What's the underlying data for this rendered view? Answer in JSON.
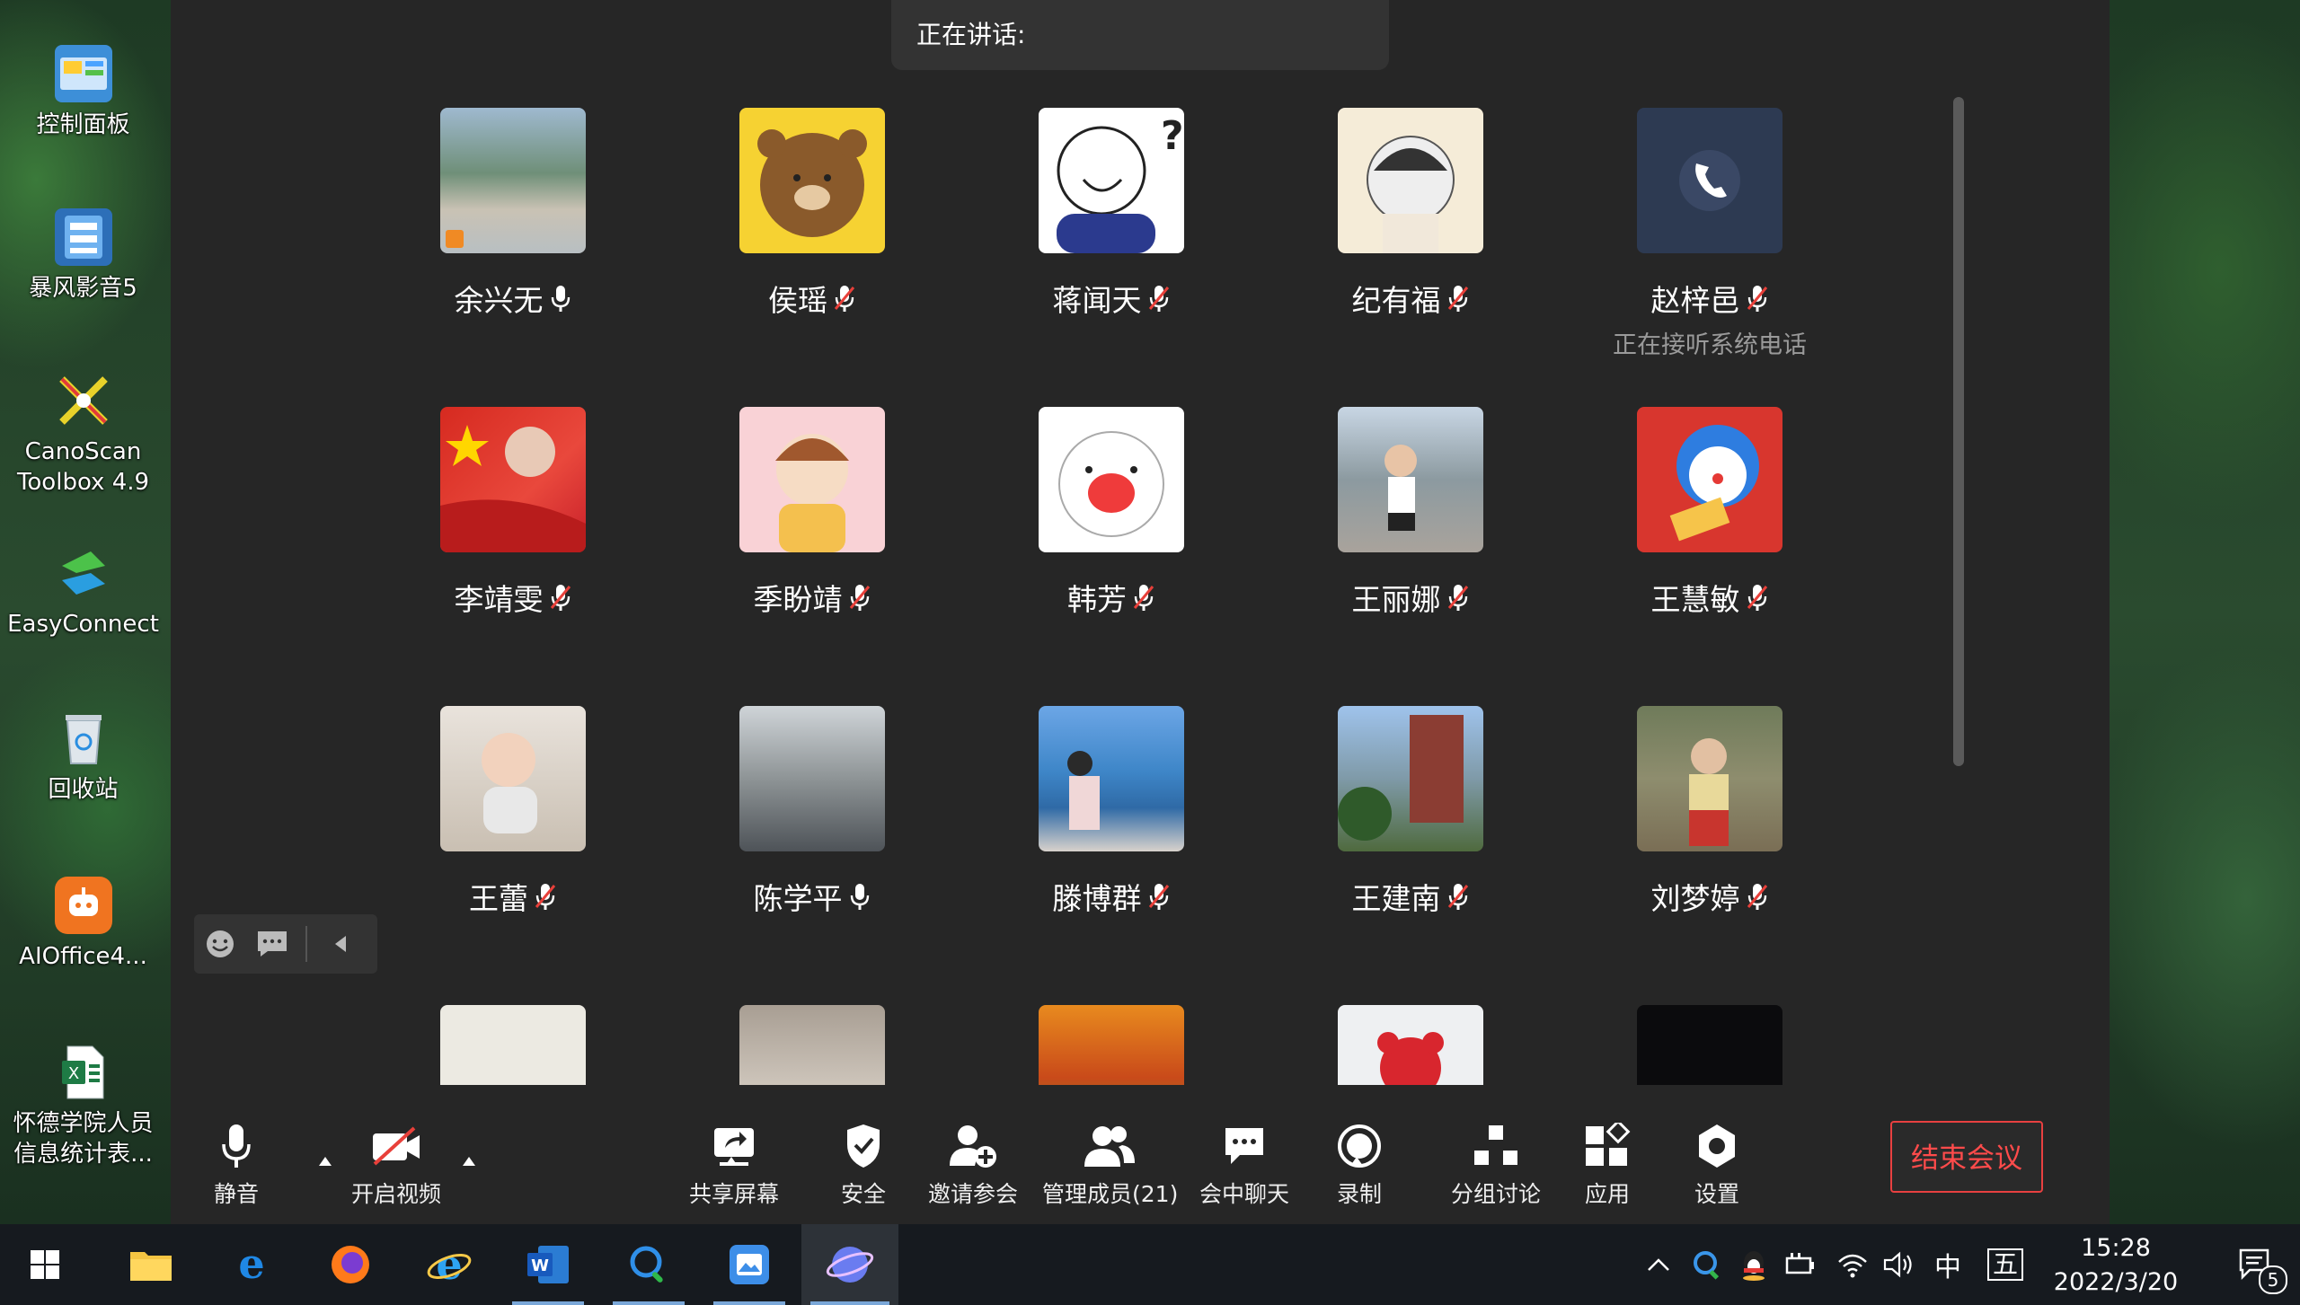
{
  "desktop": {
    "icons": [
      {
        "label": "控制面板"
      },
      {
        "label": "暴风影音5"
      },
      {
        "label": "CanoScan Toolbox 4.9"
      },
      {
        "label": "EasyConnect"
      },
      {
        "label": "回收站"
      },
      {
        "label": "AIOffice4..."
      },
      {
        "label": "怀德学院人员信息统计表..."
      }
    ]
  },
  "meeting": {
    "speaking_label": "正在讲话:",
    "participants": [
      {
        "name": "余兴无",
        "mic": "on",
        "status": ""
      },
      {
        "name": "侯瑶",
        "mic": "muted",
        "status": ""
      },
      {
        "name": "蒋闻天",
        "mic": "muted",
        "status": ""
      },
      {
        "name": "纪有福",
        "mic": "muted",
        "status": ""
      },
      {
        "name": "赵梓邑",
        "mic": "muted",
        "status": "正在接听系统电话"
      },
      {
        "name": "李靖雯",
        "mic": "muted",
        "status": ""
      },
      {
        "name": "季盼靖",
        "mic": "muted",
        "status": ""
      },
      {
        "name": "韩芳",
        "mic": "muted",
        "status": ""
      },
      {
        "name": "王丽娜",
        "mic": "muted",
        "status": ""
      },
      {
        "name": "王慧敏",
        "mic": "muted",
        "status": ""
      },
      {
        "name": "王蕾",
        "mic": "muted",
        "status": ""
      },
      {
        "name": "陈学平",
        "mic": "on",
        "status": ""
      },
      {
        "name": "滕博群",
        "mic": "muted",
        "status": ""
      },
      {
        "name": "王建南",
        "mic": "muted",
        "status": ""
      },
      {
        "name": "刘梦婷",
        "mic": "muted",
        "status": ""
      }
    ],
    "toolbar": {
      "mute": "静音",
      "video": "开启视频",
      "share": "共享屏幕",
      "security": "安全",
      "invite": "邀请参会",
      "members": "管理成员(21)",
      "chat": "会中聊天",
      "record": "录制",
      "breakout": "分组讨论",
      "apps": "应用",
      "settings": "设置",
      "end": "结束会议"
    }
  },
  "taskbar": {
    "ime_lang": "中",
    "ime_mode": "五",
    "time": "15:28",
    "date": "2022/3/20",
    "notification_count": "5"
  },
  "colors": {
    "window_bg": "#262626",
    "end_button": "#e84040",
    "taskbar_bg": "#161a1f"
  }
}
